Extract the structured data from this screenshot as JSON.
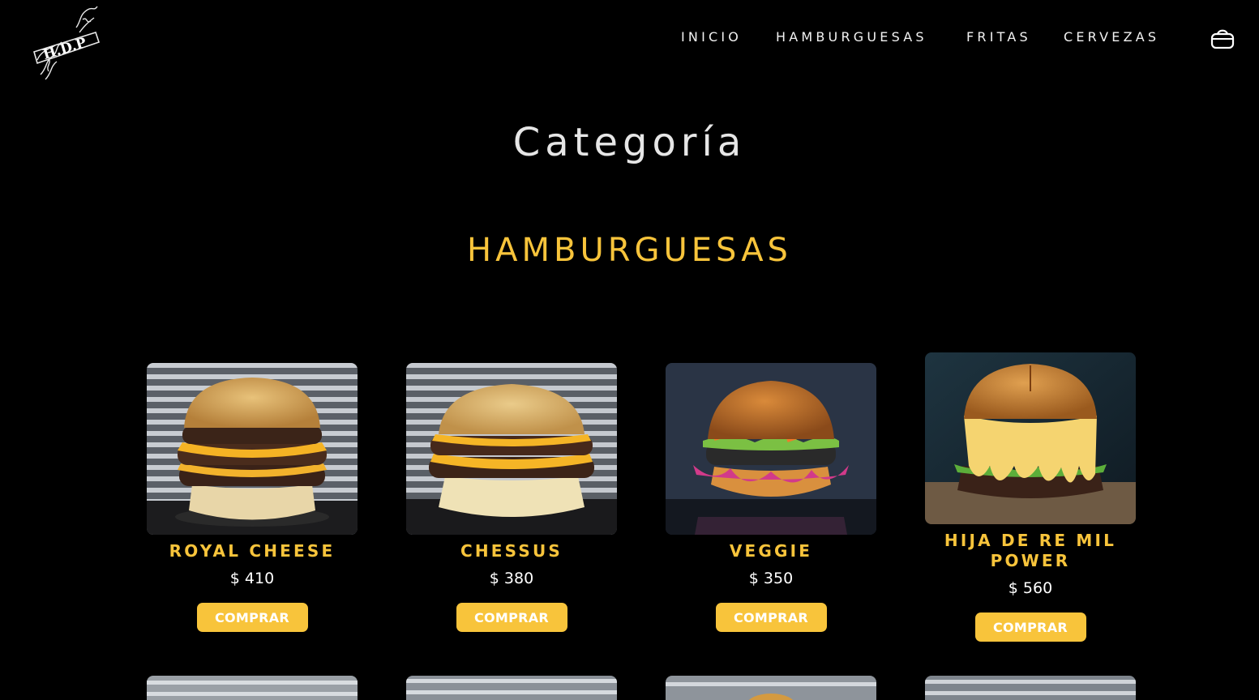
{
  "header": {
    "logo_text": "H.D.P",
    "nav": [
      "INICIO",
      "HAMBURGUESAS",
      "FRITAS",
      "CERVEZAS"
    ],
    "cart_icon": "shopping-basket-icon"
  },
  "page_title": "Categoría",
  "section_title": "HAMBURGUESAS",
  "products": [
    {
      "name": "ROYAL CHEESE",
      "price": "$ 410",
      "button": "COMPRAR",
      "image": "burger-photo-royal-cheese"
    },
    {
      "name": "CHESSUS",
      "price": "$ 380",
      "button": "COMPRAR",
      "image": "burger-photo-chessus"
    },
    {
      "name": "VEGGIE",
      "price": "$ 350",
      "button": "COMPRAR",
      "image": "burger-photo-veggie"
    },
    {
      "name": "HIJA DE RE MIL POWER",
      "price": "$ 560",
      "button": "COMPRAR",
      "image": "burger-photo-hija-de-re-mil-power"
    }
  ],
  "colors": {
    "background": "#000000",
    "accent": "#f8c43b",
    "text": "#ffffff"
  }
}
